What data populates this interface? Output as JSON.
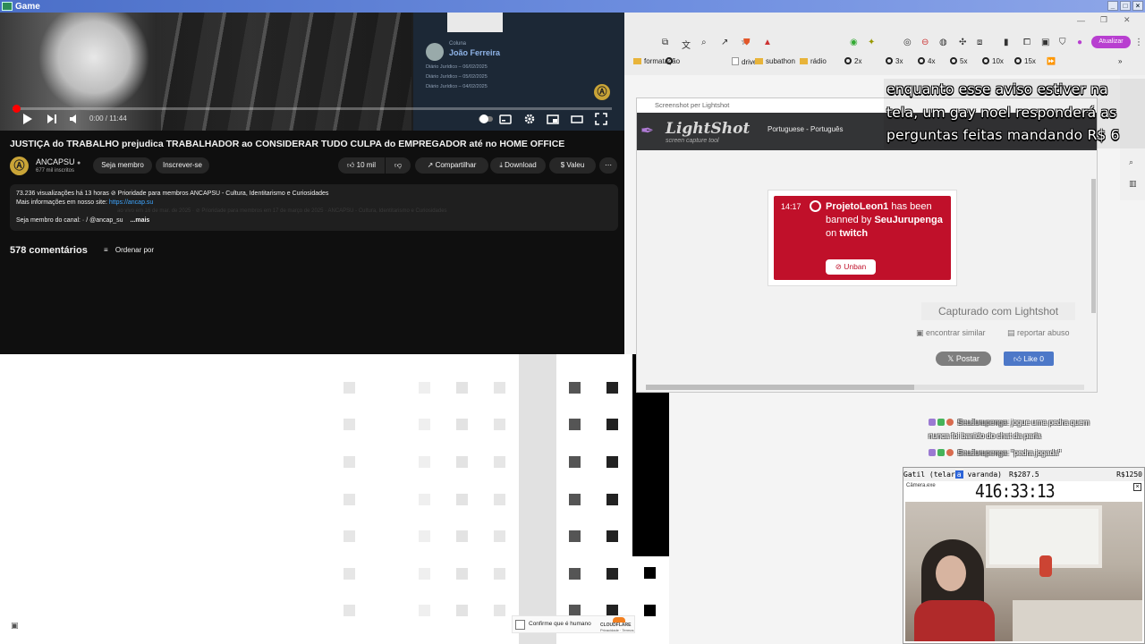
{
  "game_window": {
    "title": "Game"
  },
  "youtube": {
    "video": {
      "column_label": "Coluna",
      "column_author": "João Ferreira",
      "diario_lines": [
        "Diário Jurídico – 06/02/2025",
        "Diário Jurídico – 05/02/2025",
        "Diário Jurídico – 04/02/2025"
      ],
      "timecode": "0:00 / 11:44",
      "progress": 0
    },
    "title": "JUSTIÇA do TRABALHO prejudica TRABALHADOR ao CONSIDERAR TUDO CULPA do EMPREGADOR até no HOME OFFICE",
    "channel": {
      "name": "ANCAPSU",
      "subs": "677 mil inscritos",
      "logo": "Ⓐ"
    },
    "buttons": {
      "join": "Seja membro",
      "subscribe": "Inscrever-se",
      "likes": "10 mil",
      "share": "Compartilhar",
      "download": "Download",
      "thanks": "Valeu",
      "more": "⋯"
    },
    "description": {
      "line1": "73.236 visualizações  há 13 horas  ⊘ Prioridade para membros  ANCAPSU - Cultura, Identitarismo e Curiosidades",
      "line2_prefix": "Mais informações em nosso site: ",
      "line2_link": "https://ancap.su",
      "line3": "Seja membro do canal:   ·  / @ancap_su",
      "more": "...mais",
      "ghost": "ao vivo em 16 de mar. de 2025 · ⊘ Prioridade para membros em 17 de março de 2025 · ANCAPSU - Cultura, Identitarismo e Curiosidades"
    },
    "comments_count": "578 comentários",
    "sort_by": "Ordenar por"
  },
  "captcha": {
    "label": "Confirme que é humano",
    "brand": "CLOUDFLARE",
    "links": "Privacidade · Termos"
  },
  "browser": {
    "update_button": "Atualizar",
    "bookmarks": [
      {
        "icon": "folder",
        "label": "formatação"
      },
      {
        "icon": "circle",
        "label": ""
      },
      {
        "icon": "page",
        "label": "driver"
      },
      {
        "icon": "folder",
        "label": "subathon"
      },
      {
        "icon": "folder",
        "label": "rádio"
      },
      {
        "icon": "circle",
        "label": "2x"
      },
      {
        "icon": "circle",
        "label": "3x"
      },
      {
        "icon": "circle",
        "label": "4x"
      },
      {
        "icon": "circle",
        "label": "5x"
      },
      {
        "icon": "circle",
        "label": "10x"
      },
      {
        "icon": "circle",
        "label": "15x"
      }
    ]
  },
  "lightshot": {
    "window_title": "Screenshot per Lightshot",
    "logo": "LightShot",
    "logo_sub": "screen capture tool",
    "language": "Portuguese - Português",
    "banner": {
      "time": "14:17",
      "user": "ProjetoLeon1",
      "text1": " has been banned by ",
      "mod": "SeuJurupenga",
      "text2": " on ",
      "platform": "twitch",
      "unban": "Unban"
    },
    "captured": "Capturado com Lightshot",
    "find_similar": "encontrar similar",
    "report": "reportar abuso",
    "post": "Postar",
    "like": "Like 0"
  },
  "overlay": {
    "line1": "enquanto esse aviso estiver na",
    "line2": "tela, um gay noel responderá as",
    "line3": "perguntas feitas mandando R$ 6"
  },
  "chat": [
    {
      "user": "SeuJurupenga",
      "msg": ": jogue uma pedra quem",
      "cont": "nunca foi banido do chat da parla"
    },
    {
      "user": "SeuJurupenga",
      "msg": ": \"pedra jogada\""
    }
  ],
  "camera": {
    "header_label": "Gatil (telar",
    "header_hl": "a",
    "header_label2": " varanda)",
    "price1": "R$287.5",
    "price2": "R$1250",
    "cam_title": "Câmera.exe",
    "timer": "416:33:13"
  }
}
